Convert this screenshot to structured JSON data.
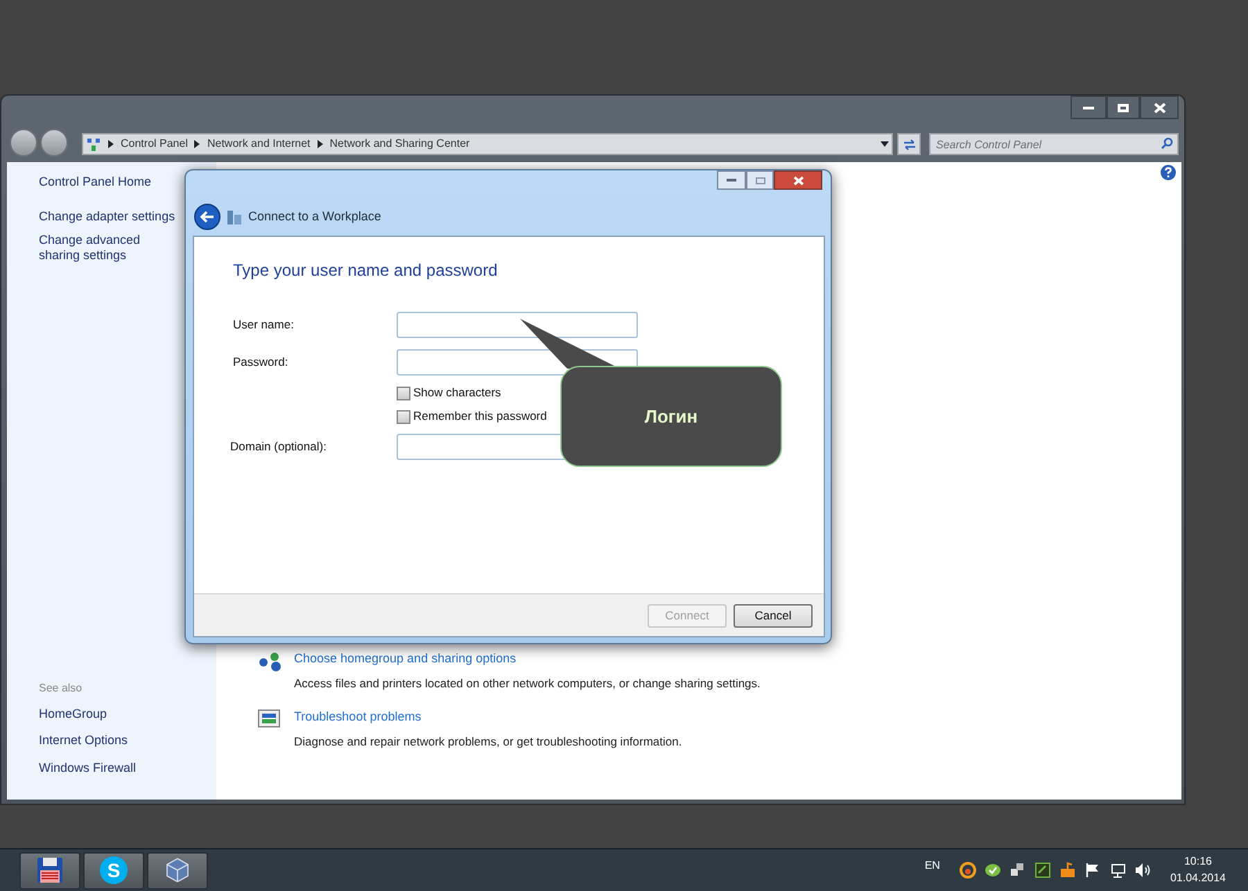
{
  "window": {
    "address": {
      "crumbs": [
        "Control Panel",
        "Network and Internet",
        "Network and Sharing Center"
      ]
    },
    "search": {
      "placeholder": "Search Control Panel"
    },
    "sidebar": {
      "links": [
        "Control Panel Home",
        "Change adapter settings",
        "Change advanced sharing settings"
      ],
      "see_also_title": "See also",
      "see_also": [
        "HomeGroup",
        "Internet Options",
        "Windows Firewall"
      ]
    },
    "tasks": [
      {
        "kind": "homegroup",
        "title": "Choose homegroup and sharing options",
        "description": "Access files and printers located on other network computers, or change sharing settings."
      },
      {
        "kind": "troubleshoot",
        "title": "Troubleshoot problems",
        "description": "Diagnose and repair network problems, or get troubleshooting information."
      }
    ]
  },
  "dialog": {
    "title": "Connect to a Workplace",
    "heading": "Type your user name and password",
    "fields": [
      {
        "kind": "text",
        "label": "User name:"
      },
      {
        "kind": "text",
        "label": "Password:"
      },
      {
        "kind": "check",
        "label": "Show characters",
        "checked": false
      },
      {
        "kind": "check",
        "label": "Remember this password",
        "checked": false
      },
      {
        "kind": "text",
        "label": "Domain (optional):"
      }
    ],
    "buttons": [
      {
        "label": "Connect",
        "disabled": true
      },
      {
        "label": "Cancel",
        "disabled": false
      }
    ]
  },
  "callout": {
    "text": "Логин"
  },
  "taskbar": {
    "apps": [
      {
        "kind": "floppy"
      },
      {
        "kind": "skype",
        "letter": "S"
      },
      {
        "kind": "cube"
      }
    ],
    "language": "EN",
    "time": "10:16",
    "date": "01.04.2014"
  }
}
